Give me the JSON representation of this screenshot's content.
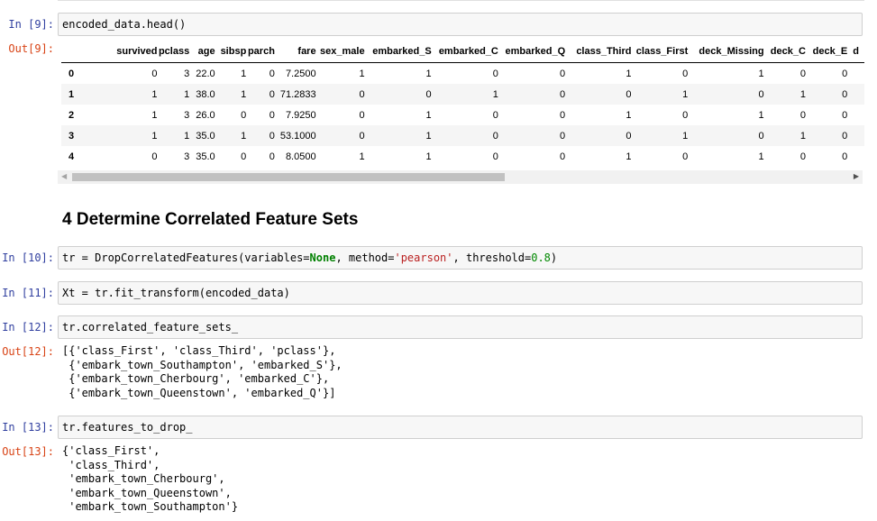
{
  "cells": {
    "c9": {
      "in_prompt": "In [9]:",
      "out_prompt": "Out[9]:",
      "code": "encoded_data.head()"
    },
    "heading": "4  Determine Correlated Feature Sets",
    "c10": {
      "in_prompt": "In [10]:",
      "code_pre": "tr = DropCorrelatedFeatures(variables=",
      "kw": "None",
      "mid": ", method=",
      "str": "'pearson'",
      "mid2": ", threshold=",
      "num": "0.8",
      "post": ")"
    },
    "c11": {
      "in_prompt": "In [11]:",
      "code": "Xt = tr.fit_transform(encoded_data)"
    },
    "c12": {
      "in_prompt": "In [12]:",
      "out_prompt": "Out[12]:",
      "code": "tr.correlated_feature_sets_",
      "output": "[{'class_First', 'class_Third', 'pclass'},\n {'embark_town_Southampton', 'embarked_S'},\n {'embark_town_Cherbourg', 'embarked_C'},\n {'embark_town_Queenstown', 'embarked_Q'}]"
    },
    "c13": {
      "in_prompt": "In [13]:",
      "out_prompt": "Out[13]:",
      "code": "tr.features_to_drop_",
      "output": "{'class_First',\n 'class_Third',\n 'embark_town_Cherbourg',\n 'embark_town_Queenstown',\n 'embark_town_Southampton'}"
    }
  },
  "dataframe": {
    "columns": [
      "survived",
      "pclass",
      "age",
      "sibsp",
      "parch",
      "fare",
      "sex_male",
      "embarked_S",
      "embarked_C",
      "embarked_Q",
      "class_Third",
      "class_First",
      "deck_Missing",
      "deck_C",
      "deck_E",
      "d"
    ],
    "rows": [
      {
        "index": "0",
        "cells": [
          "0",
          "3",
          "22.0",
          "1",
          "0",
          "7.2500",
          "1",
          "1",
          "0",
          "0",
          "1",
          "0",
          "1",
          "0",
          "0",
          ""
        ]
      },
      {
        "index": "1",
        "cells": [
          "1",
          "1",
          "38.0",
          "1",
          "0",
          "71.2833",
          "0",
          "0",
          "1",
          "0",
          "0",
          "1",
          "0",
          "1",
          "0",
          ""
        ]
      },
      {
        "index": "2",
        "cells": [
          "1",
          "3",
          "26.0",
          "0",
          "0",
          "7.9250",
          "0",
          "1",
          "0",
          "0",
          "1",
          "0",
          "1",
          "0",
          "0",
          ""
        ]
      },
      {
        "index": "3",
        "cells": [
          "1",
          "1",
          "35.0",
          "1",
          "0",
          "53.1000",
          "0",
          "1",
          "0",
          "0",
          "0",
          "1",
          "0",
          "1",
          "0",
          ""
        ]
      },
      {
        "index": "4",
        "cells": [
          "0",
          "3",
          "35.0",
          "0",
          "0",
          "8.0500",
          "1",
          "1",
          "0",
          "0",
          "1",
          "0",
          "1",
          "0",
          "0",
          ""
        ]
      }
    ]
  }
}
